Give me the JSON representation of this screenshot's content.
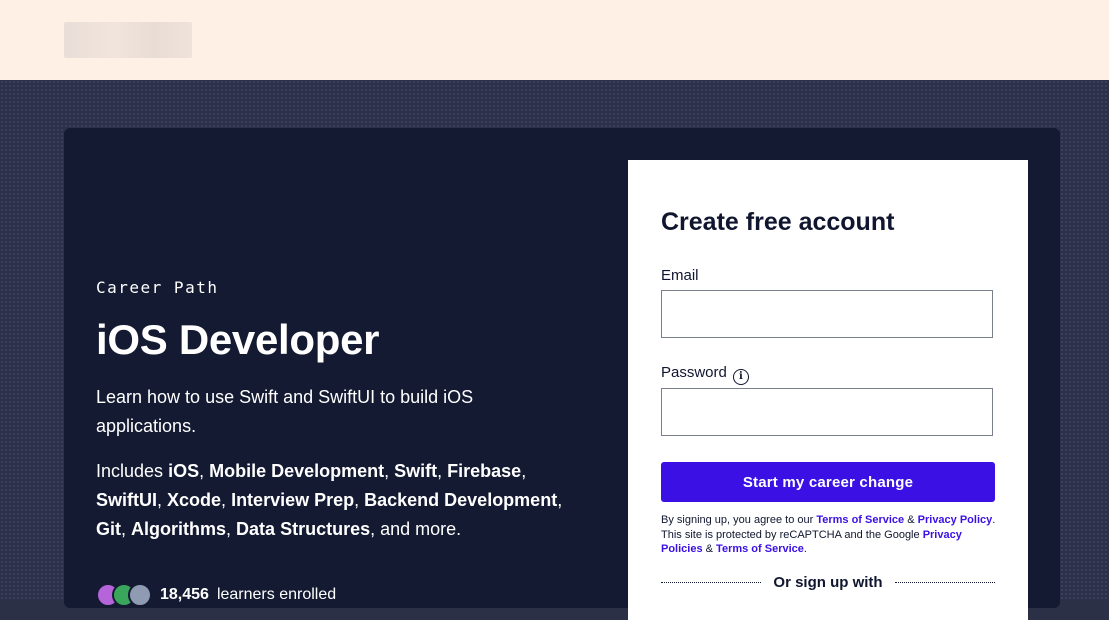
{
  "header": {
    "logo_alt": ""
  },
  "hero": {
    "eyebrow": "Career Path",
    "title": "iOS Developer",
    "description": "Learn how to use Swift and SwiftUI to build iOS applications.",
    "includes_prefix": "Includes",
    "topics": [
      "iOS",
      "Mobile Development",
      "Swift",
      "Firebase",
      "SwiftUI",
      "Xcode",
      "Interview Prep",
      "Backend Development",
      "Git",
      "Algorithms",
      "Data Structures"
    ],
    "includes_suffix": "and more.",
    "learners_count": "18,456",
    "learners_label": "learners enrolled"
  },
  "signup": {
    "title": "Create free account",
    "email_label": "Email",
    "email_value": "",
    "password_label": "Password",
    "password_value": "",
    "submit_label": "Start my career change",
    "legal": {
      "prefix": "By signing up, you agree to our",
      "terms": "Terms of Service",
      "amp": "&",
      "privacy": "Privacy Policy",
      "middle": ". This site is protected by reCAPTCHA and the Google",
      "google_privacy": "Privacy Policies",
      "amp2": "&",
      "google_terms": "Terms of Service",
      "end": "."
    },
    "divider_label": "Or sign up with"
  },
  "colors": {
    "header_bg": "#fff0e5",
    "hero_bg": "#141a32",
    "accent": "#3a10e5"
  }
}
